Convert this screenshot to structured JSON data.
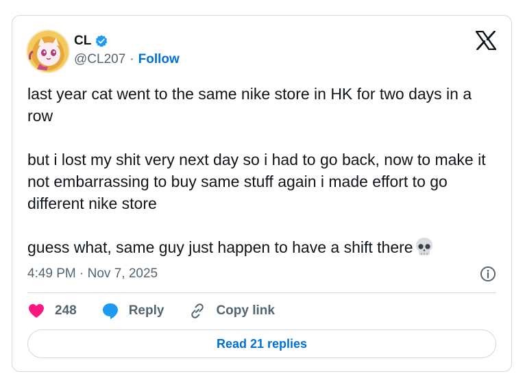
{
  "author": {
    "display_name": "CL",
    "handle": "@CL207",
    "separator": "·",
    "follow_label": "Follow",
    "verified": true
  },
  "tweet": {
    "paragraphs": [
      "last year cat went to the same nike store in HK for two days in a row",
      "but i lost my shit very next day so i had to go back, now to make it not embarrassing to buy same stuff again i made effort to go different nike store",
      "guess what, same guy just happen to have a shift there"
    ],
    "emoji": "skull-emoji",
    "timestamp": "4:49 PM · Nov 7, 2025"
  },
  "actions": {
    "like_count": "248",
    "reply_label": "Reply",
    "copy_link_label": "Copy link"
  },
  "read_replies_label": "Read 21 replies",
  "colors": {
    "link_blue": "#006fd6",
    "like_pink": "#f91880",
    "reply_blue": "#1d9bf0",
    "secondary_text": "#536471",
    "border": "#cfd9de"
  },
  "icons": [
    "x-logo-icon",
    "verified-badge-icon",
    "heart-icon",
    "reply-bubble-icon",
    "link-icon",
    "info-icon",
    "skull-emoji-icon"
  ]
}
